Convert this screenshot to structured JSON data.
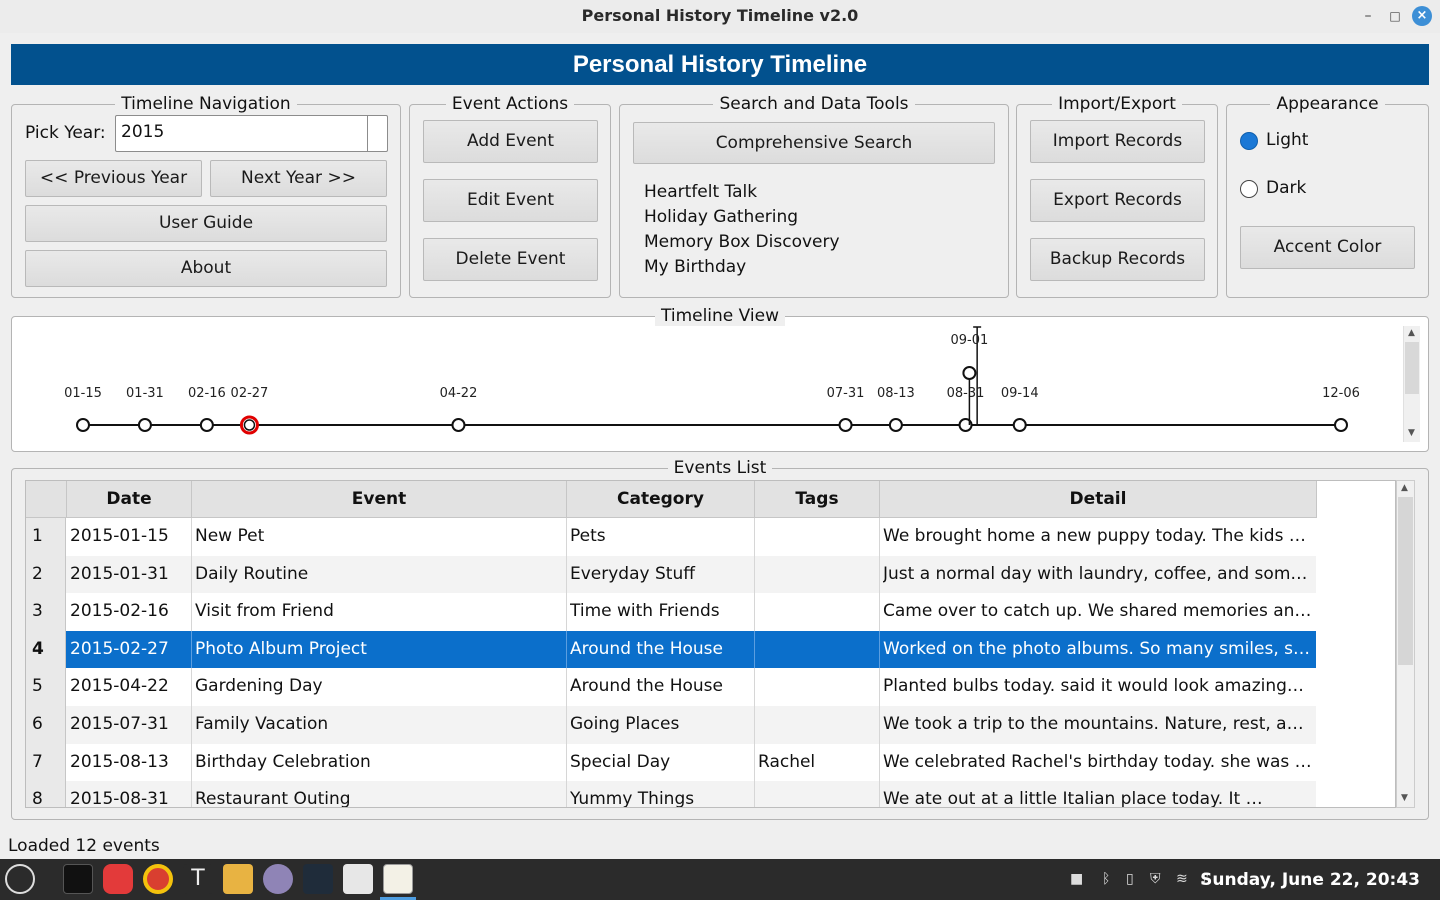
{
  "window": {
    "title": "Personal History Timeline v2.0",
    "minimize_glyph": "–",
    "maximize_glyph": "□",
    "close_glyph": "×"
  },
  "banner": {
    "title": "Personal History Timeline"
  },
  "navigation": {
    "group_title": "Timeline Navigation",
    "pick_year_label": "Pick Year:",
    "year_value": "2015",
    "prev_label": "<< Previous Year",
    "next_label": "Next Year >>",
    "guide_label": "User Guide",
    "about_label": "About"
  },
  "event_actions": {
    "group_title": "Event Actions",
    "add_label": "Add Event",
    "edit_label": "Edit Event",
    "delete_label": "Delete Event"
  },
  "search": {
    "group_title": "Search and Data Tools",
    "button_label": "Comprehensive Search",
    "results": [
      "Heartfelt Talk",
      "Holiday Gathering",
      "Memory Box Discovery",
      "My Birthday"
    ]
  },
  "import_export": {
    "group_title": "Import/Export",
    "import_label": "Import Records",
    "export_label": "Export Records",
    "backup_label": "Backup Records"
  },
  "appearance": {
    "group_title": "Appearance",
    "light_label": "Light",
    "dark_label": "Dark",
    "selected": "Light",
    "accent_label": "Accent Color"
  },
  "timeline": {
    "group_title": "Timeline View",
    "selected_date": "02-27",
    "points": [
      {
        "date": "01-15"
      },
      {
        "date": "01-31"
      },
      {
        "date": "02-16"
      },
      {
        "date": "02-27"
      },
      {
        "date": "04-22"
      },
      {
        "date": "07-31"
      },
      {
        "date": "08-13"
      },
      {
        "date": "08-31"
      },
      {
        "date": "09-01"
      },
      {
        "date": "09-14"
      },
      {
        "date": "12-06"
      }
    ]
  },
  "events_list": {
    "group_title": "Events List",
    "columns": [
      "Date",
      "Event",
      "Category",
      "Tags",
      "Detail"
    ],
    "selected_row": 4,
    "rows": [
      {
        "n": "1",
        "date": "2015-01-15",
        "event": "New Pet",
        "category": "Pets",
        "tags": "",
        "detail": "We brought home a new puppy today. The kids …"
      },
      {
        "n": "2",
        "date": "2015-01-31",
        "event": "Daily Routine",
        "category": "Everyday Stuff",
        "tags": "",
        "detail": "Just a normal day with laundry, coffee, and som…"
      },
      {
        "n": "3",
        "date": "2015-02-16",
        "event": "Visit from Friend",
        "category": "Time with Friends",
        "tags": "",
        "detail": "Came over to catch up. We shared memories an…"
      },
      {
        "n": "4",
        "date": "2015-02-27",
        "event": "Photo Album Project",
        "category": "Around the House",
        "tags": "",
        "detail": "Worked on the photo albums. So many smiles, s…"
      },
      {
        "n": "5",
        "date": "2015-04-22",
        "event": "Gardening Day",
        "category": "Around the House",
        "tags": "",
        "detail": "Planted bulbs today.  said it would look amazing…"
      },
      {
        "n": "6",
        "date": "2015-07-31",
        "event": "Family Vacation",
        "category": "Going Places",
        "tags": "",
        "detail": "We took a trip to the mountains. Nature, rest, a…"
      },
      {
        "n": "7",
        "date": "2015-08-13",
        "event": "Birthday Celebration",
        "category": "Special Day",
        "tags": "Rachel",
        "detail": "We celebrated Rachel's birthday today. she was …"
      },
      {
        "n": "8",
        "date": "2015-08-31",
        "event": "Restaurant Outing",
        "category": "Yummy Things",
        "tags": "",
        "detail": "We ate out at a little Italian place today. It …"
      }
    ]
  },
  "status": {
    "text": "Loaded 12 events"
  },
  "taskbar": {
    "clock": "Sunday, June 22, 20:43",
    "apps": [
      "menu-icon",
      "terminal-icon",
      "vivaldi-icon",
      "chrome-icon",
      "typora-icon",
      "files-icon",
      "camera-icon",
      "kvantum-icon",
      "text-editor-icon",
      "timeline-app-icon"
    ]
  },
  "colors": {
    "banner": "#02518e",
    "selection": "#0b6fcb",
    "selected_marker": "#e00000"
  }
}
